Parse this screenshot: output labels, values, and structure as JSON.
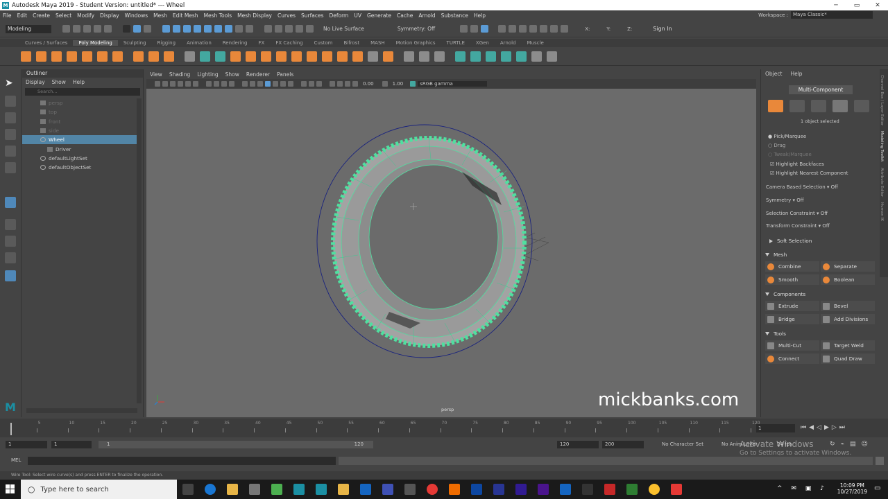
{
  "window": {
    "title": "Autodesk Maya 2019 - Student Version: untitled*   ---   Wheel"
  },
  "menubar": [
    "File",
    "Edit",
    "Create",
    "Select",
    "Modify",
    "Display",
    "Windows",
    "Mesh",
    "Edit Mesh",
    "Mesh Tools",
    "Mesh Display",
    "Curves",
    "Surfaces",
    "Deform",
    "UV",
    "Generate",
    "Cache",
    "Arnold",
    "Substance",
    "Help"
  ],
  "workspace": {
    "label": "Workspace :",
    "value": "Maya Classic*"
  },
  "statusline": {
    "mode": "Modeling",
    "live_surface": "No Live Surface",
    "symmetry": "Symmetry: Off",
    "x_label": "X:",
    "y_label": "Y:",
    "z_label": "Z:",
    "sign_in": "Sign In"
  },
  "shelf_tabs": [
    "Curves / Surfaces",
    "Poly Modeling",
    "Sculpting",
    "Rigging",
    "Animation",
    "Rendering",
    "FX",
    "FX Caching",
    "Custom",
    "Bifrost",
    "MASH",
    "Motion Graphics",
    "TURTLE",
    "XGen",
    "Arnold",
    "Muscle"
  ],
  "shelf_active": "Poly Modeling",
  "outliner": {
    "title": "Outliner",
    "menu": [
      "Display",
      "Show",
      "Help"
    ],
    "search_placeholder": "Search...",
    "items": [
      {
        "label": "persp",
        "state": "dim"
      },
      {
        "label": "top",
        "state": "dim"
      },
      {
        "label": "front",
        "state": "dim"
      },
      {
        "label": "side",
        "state": "dim"
      },
      {
        "label": "Wheel",
        "state": "selected"
      },
      {
        "label": "Driver",
        "state": "indent"
      },
      {
        "label": "defaultLightSet",
        "state": "set"
      },
      {
        "label": "defaultObjectSet",
        "state": "set"
      }
    ]
  },
  "viewport": {
    "menu": [
      "View",
      "Shading",
      "Lighting",
      "Show",
      "Renderer",
      "Panels"
    ],
    "exposure": "0.00",
    "gamma": "1.00",
    "colorspace": "sRGB gamma",
    "camera_label": "persp"
  },
  "watermark": "mickbanks.com",
  "modeling_toolkit": {
    "menu": [
      "Object",
      "Help"
    ],
    "mode_button": "Multi-Component",
    "selection_info": "1 object selected",
    "options": [
      "Pick/Marquee",
      "Drag",
      "Tweak/Marquee"
    ],
    "checks": [
      "Highlight Backfaces",
      "Highlight Nearest Component"
    ],
    "settings": [
      {
        "label": "Camera Based Selection",
        "value": "Off"
      },
      {
        "label": "Symmetry",
        "value": "Off"
      },
      {
        "label": "Selection Constraint",
        "value": "Off"
      },
      {
        "label": "Transform Constraint",
        "value": "Off"
      }
    ],
    "soft_selection": "Soft Selection",
    "sections": {
      "mesh": {
        "title": "Mesh",
        "tools": [
          "Combine",
          "Separate",
          "Smooth",
          "Boolean"
        ]
      },
      "components": {
        "title": "Components",
        "tools": [
          "Extrude",
          "Bevel",
          "Bridge",
          "Add Divisions"
        ]
      },
      "tools": {
        "title": "Tools",
        "tools": [
          "Multi-Cut",
          "Target Weld",
          "Connect",
          "Quad Draw"
        ]
      }
    },
    "side_tabs": [
      "Channel Box / Layer Editor",
      "Modeling Toolkit",
      "Attribute Editor",
      "Human IK"
    ]
  },
  "timeline": {
    "ticks": [
      "5",
      "10",
      "15",
      "20",
      "25",
      "30",
      "35",
      "40",
      "45",
      "50",
      "55",
      "60",
      "65",
      "70",
      "75",
      "80",
      "85",
      "90",
      "95",
      "100",
      "105",
      "110",
      "115",
      "120"
    ],
    "current_frame": "1"
  },
  "range": {
    "start": "1",
    "playback_start": "1",
    "range_start_inner": "1",
    "range_end_inner": "120",
    "playback_end": "120",
    "end": "200",
    "character_set": "No Character Set",
    "anim_layer": "No Anim Layer",
    "fps": "24 fps"
  },
  "cmdline": {
    "label": "MEL"
  },
  "helpline": "Wire Tool: Select wire curve(s) and press ENTER to finalize the operation.",
  "activate_windows": {
    "line1": "Activate Windows",
    "line2": "Go to Settings to activate Windows."
  },
  "taskbar": {
    "search_placeholder": "Type here to search",
    "time": "10:09 PM",
    "date": "10/27/2019"
  },
  "colors": {
    "maya_orange": "#e9883a",
    "maya_teal": "#43a8a0",
    "selection_blue": "#5285a6",
    "wireframe_green": "#4fe0a0"
  }
}
